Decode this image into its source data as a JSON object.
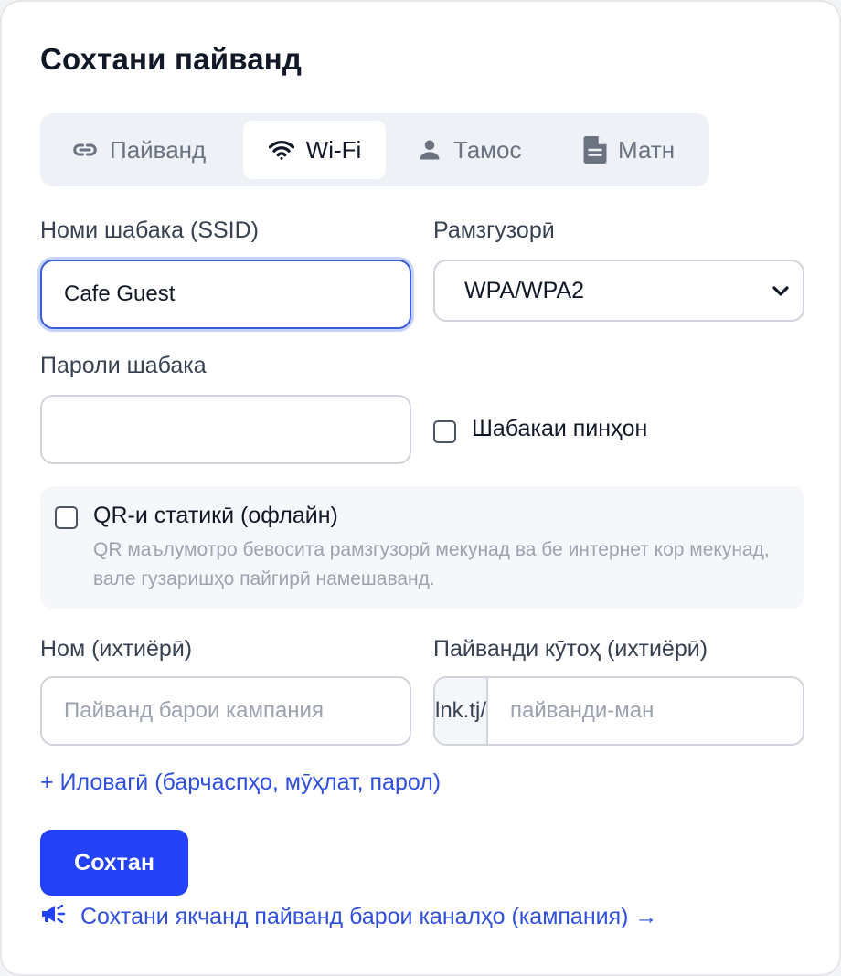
{
  "title": "Сохтани пайванд",
  "tabs": [
    {
      "label": "Пайванд",
      "icon": "link-icon",
      "active": false
    },
    {
      "label": "Wi-Fi",
      "icon": "wifi-icon",
      "active": true
    },
    {
      "label": "Тамос",
      "icon": "person-icon",
      "active": false
    },
    {
      "label": "Матн",
      "icon": "document-icon",
      "active": false
    }
  ],
  "ssid": {
    "label": "Номи шабака (SSID)",
    "value": "Cafe Guest"
  },
  "encryption": {
    "label": "Рамзгузорӣ",
    "selected": "WPA/WPA2"
  },
  "password": {
    "label": "Пароли шабака",
    "value": ""
  },
  "hidden_network": {
    "label": "Шабакаи пинҳон",
    "checked": false
  },
  "static_qr": {
    "label": "QR-и статикӣ (офлайн)",
    "checked": false,
    "description": "QR маълумотро бевосита рамзгузорӣ мекунад ва бе интернет кор мекунад, вале гузаришҳо пайгирӣ намешаванд."
  },
  "name": {
    "label": "Ном (ихтиёрӣ)",
    "placeholder": "Пайванд барои кампания",
    "value": ""
  },
  "short_link": {
    "label": "Пайванди кӯтоҳ (ихтиёрӣ)",
    "prefix": "lnk.tj/",
    "placeholder": "пайванди-ман",
    "value": ""
  },
  "advanced_link": "+ Иловагӣ (барчаспҳо, мӯҳлат, парол)",
  "submit_label": "Сохтан",
  "campaign_link": "Сохтани якчанд пайванд барои каналҳо (кампания) →",
  "colors": {
    "accent": "#2342f5",
    "link": "#2f4fdc",
    "focus": "#3b5bdb"
  }
}
